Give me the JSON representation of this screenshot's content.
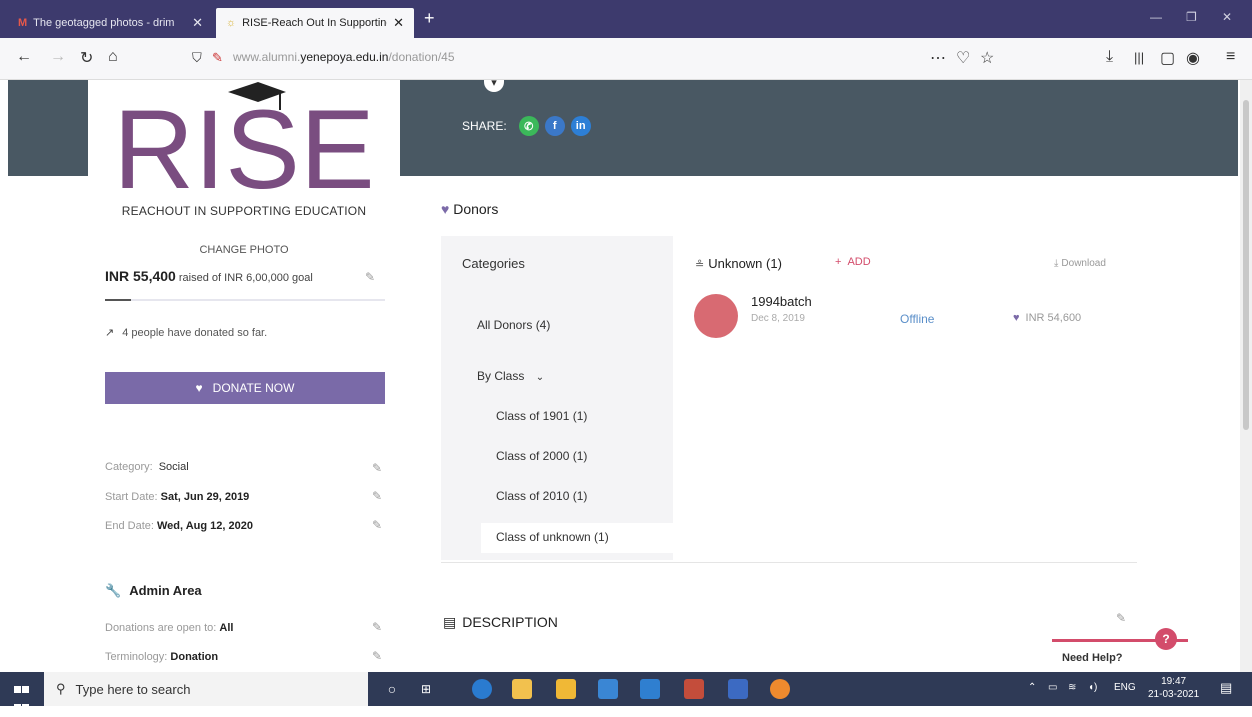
{
  "browser": {
    "tabs": [
      {
        "favicon": "M",
        "title": "The geotagged photos - drim"
      },
      {
        "favicon": "☼",
        "title": "RISE-Reach Out In Supporting"
      }
    ],
    "url_prefix": "www.alumni.",
    "url_domain": "yenepoya.edu.in",
    "url_path": "/donation/45"
  },
  "sidebar": {
    "logo_text": "RISE",
    "logo_sub": "REACHOUT IN SUPPORTING EDUCATION",
    "change_photo": "CHANGE PHOTO",
    "raised_amount": "INR 55,400",
    "raised_goal": "raised of INR 6,00,000 goal",
    "progress_fraction": 0.092,
    "donated_text": "4 people have donated so far.",
    "donate_label": "DONATE NOW",
    "category_label": "Category:",
    "category_value": "Social",
    "start_label": "Start Date:",
    "start_value": "Sat, Jun 29, 2019",
    "end_label": "End Date:",
    "end_value": "Wed, Aug 12, 2020",
    "admin_title": "Admin Area",
    "open_label": "Donations are open to:",
    "open_value": "All",
    "term_label": "Terminology:",
    "term_value": "Donation"
  },
  "share": {
    "label": "SHARE:"
  },
  "donors": {
    "title": "Donors",
    "categories_title": "Categories",
    "all_donors": "All Donors (4)",
    "by_class": "By Class",
    "classes": [
      "Class of 1901 (1)",
      "Class of 2000 (1)",
      "Class of 2010 (1)",
      "Class of unknown (1)"
    ],
    "list_title": "Unknown (1)",
    "add_label": "ADD",
    "download_label": "Download",
    "entries": [
      {
        "name": "1994batch",
        "date": "Dec 8, 2019",
        "mode": "Offline",
        "amount": "INR 54,600"
      }
    ]
  },
  "description": {
    "title": "DESCRIPTION"
  },
  "help": {
    "label": "Need Help?",
    "icon": "?"
  },
  "taskbar": {
    "search_placeholder": "Type here to search",
    "lang": "ENG",
    "time": "19:47",
    "date": "21-03-2021"
  }
}
